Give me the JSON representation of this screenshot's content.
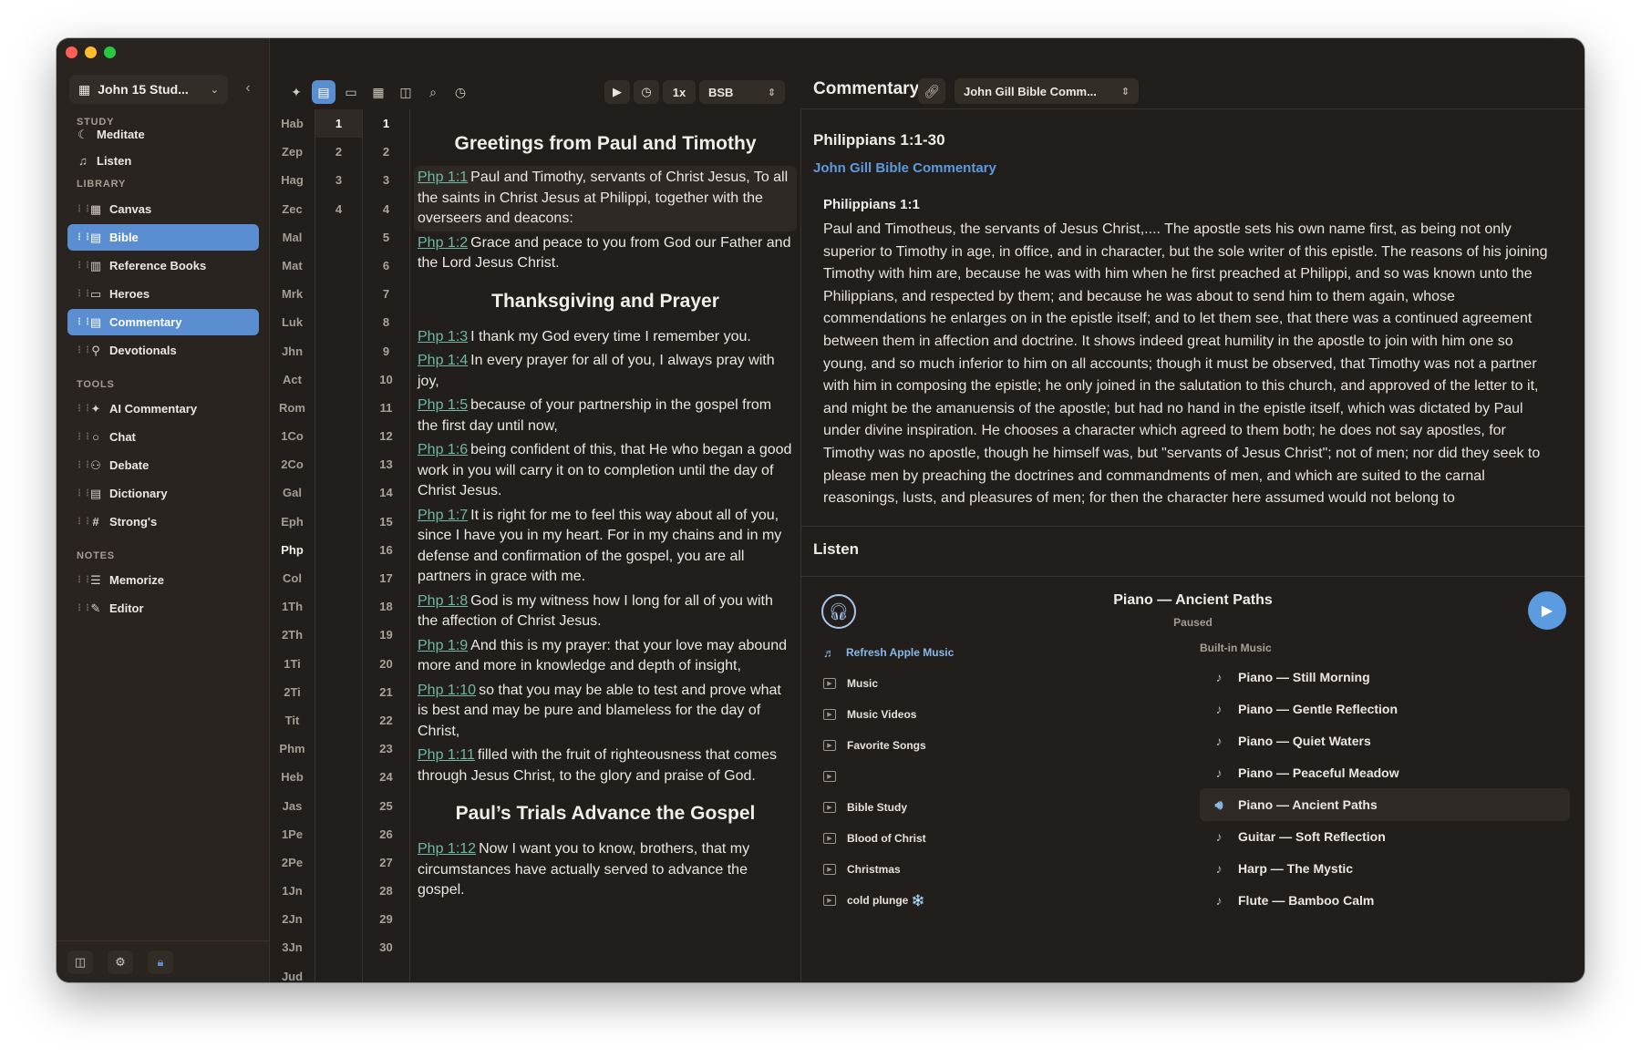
{
  "sidebar": {
    "study_name": "John 15 Stud...",
    "sections": {
      "study": "STUDY",
      "library": "LIBRARY",
      "tools": "TOOLS",
      "notes": "NOTES"
    },
    "study_items": [
      {
        "label": "Meditate",
        "icon": "moon-icon"
      },
      {
        "label": "Listen",
        "icon": "headphones-icon"
      }
    ],
    "library_items": [
      {
        "label": "Canvas",
        "icon": "grid-icon",
        "active": false
      },
      {
        "label": "Bible",
        "icon": "book-icon",
        "active": true
      },
      {
        "label": "Reference Books",
        "icon": "library-icon",
        "active": false
      },
      {
        "label": "Heroes",
        "icon": "id-card-icon",
        "active": false
      },
      {
        "label": "Commentary",
        "icon": "book-icon",
        "active": true
      },
      {
        "label": "Devotionals",
        "icon": "pray-icon",
        "active": false
      }
    ],
    "tool_items": [
      {
        "label": "AI Commentary",
        "icon": "sparkle-icon"
      },
      {
        "label": "Chat",
        "icon": "chat-bubble-icon"
      },
      {
        "label": "Debate",
        "icon": "people-icon"
      },
      {
        "label": "Dictionary",
        "icon": "dictionary-icon"
      },
      {
        "label": "Strong's",
        "icon": "hash-icon"
      }
    ],
    "note_items": [
      {
        "label": "Memorize",
        "icon": "list-icon"
      },
      {
        "label": "Editor",
        "icon": "edit-icon"
      }
    ]
  },
  "toolbar": {
    "speed": "1x",
    "translation": "BSB"
  },
  "books": [
    "Hab",
    "Zep",
    "Hag",
    "Zec",
    "Mal",
    "Mat",
    "Mrk",
    "Luk",
    "Jhn",
    "Act",
    "Rom",
    "1Co",
    "2Co",
    "Gal",
    "Eph",
    "Php",
    "Col",
    "1Th",
    "2Th",
    "1Ti",
    "2Ti",
    "Tit",
    "Phm",
    "Heb",
    "Jas",
    "1Pe",
    "2Pe",
    "1Jn",
    "2Jn",
    "3Jn",
    "Jud"
  ],
  "selected_book": "Php",
  "chapters": [
    "1",
    "2",
    "3",
    "4"
  ],
  "verse_numbers": [
    "1",
    "2",
    "3",
    "4",
    "5",
    "6",
    "7",
    "8",
    "9",
    "10",
    "11",
    "12",
    "13",
    "14",
    "15",
    "16",
    "17",
    "18",
    "19",
    "20",
    "21",
    "22",
    "23",
    "24",
    "25",
    "26",
    "27",
    "28",
    "29",
    "30"
  ],
  "passage": {
    "headings": [
      "Greetings from Paul and Timothy",
      "Thanksgiving and Prayer",
      "Paul’s Trials Advance the Gospel"
    ],
    "verses": [
      {
        "ref": "Php 1:1",
        "text": "Paul and Timothy, servants of Christ Jesus, To all the saints in Christ Jesus at Philippi, together with the overseers and deacons:"
      },
      {
        "ref": "Php 1:2",
        "text": "Grace and peace to you from God our Father and the Lord Jesus Christ."
      },
      {
        "ref": "Php 1:3",
        "text": "I thank my God every time I remember you."
      },
      {
        "ref": "Php 1:4",
        "text": "In every prayer for all of you, I always pray with joy,"
      },
      {
        "ref": "Php 1:5",
        "text": "because of your partnership in the gospel from the first day until now,"
      },
      {
        "ref": "Php 1:6",
        "text": "being confident of this, that He who began a good work in you will carry it on to completion until the day of Christ Jesus."
      },
      {
        "ref": "Php 1:7",
        "text": "It is right for me to feel this way about all of you, since I have you in my heart. For in my chains and in my defense and confirmation of the gospel, you are all partners in grace with me."
      },
      {
        "ref": "Php 1:8",
        "text": "God is my witness how I long for all of you with the affection of Christ Jesus."
      },
      {
        "ref": "Php 1:9",
        "text": "And this is my prayer: that your love may abound more and more in knowledge and depth of insight,"
      },
      {
        "ref": "Php 1:10",
        "text": "so that you may be able to test and prove what is best and may be pure and blameless for the day of Christ,"
      },
      {
        "ref": "Php 1:11",
        "text": "filled with the fruit of righteousness that comes through Jesus Christ, to the glory and praise of God."
      },
      {
        "ref": "Php 1:12",
        "text": "Now I want you to know, brothers, that my circumstances have actually served to advance the gospel."
      }
    ]
  },
  "commentary": {
    "title": "Commentary",
    "source_select": "John Gill Bible Comm...",
    "range": "Philippians 1:1-30",
    "source_name": "John Gill Bible Commentary",
    "verse_heading": "Philippians 1:1",
    "body": "Paul and Timotheus, the servants of Jesus Christ,.... The apostle sets his own name first, as being not only superior to Timothy in age, in office, and in character, but the sole writer of this epistle. The reasons of his joining Timothy with him are, because he was with him when he first preached at Philippi, and so was known unto the Philippians, and respected by them; and because he was about to send him to them again, whose commendations he enlarges on in the epistle itself; and to let them see, that there was a continued agreement between them in affection and doctrine. It shows indeed great humility in the apostle to join with him one so young, and so much inferior to him on all accounts; though it must be observed, that Timothy was not a partner with him in composing the epistle; he only joined in the salutation to this church, and approved of the letter to it, and might be the amanuensis of the apostle; but had no hand in the epistle itself, which was dictated by Paul under divine inspiration. He chooses a character which agreed to them both; he does not say apostles, for Timothy was no apostle, though he himself was, but \"servants of Jesus Christ\"; not of men; nor did they seek to please men by preaching the doctrines and commandments of men, and which are suited to the carnal reasonings, lusts, and pleasures of men; for then the character here assumed would not belong to"
  },
  "listen": {
    "title": "Listen",
    "now_playing": "Piano — Ancient Paths",
    "status": "Paused",
    "refresh_label": "Refresh Apple Music",
    "playlists": [
      "Music",
      "Music Videos",
      "Favorite Songs",
      "",
      "Bible Study",
      "Blood of Christ",
      "Christmas",
      "cold plunge ❄️"
    ],
    "builtin_label": "Built-in Music",
    "tracks": [
      "Piano — Still Morning",
      "Piano — Gentle Reflection",
      "Piano — Quiet Waters",
      "Piano — Peaceful Meadow",
      "Piano — Ancient Paths",
      "Guitar — Soft Reflection",
      "Harp — The Mystic",
      "Flute — Bamboo Calm"
    ],
    "playing_index": 4
  },
  "colors": {
    "accent": "#5b8ed1",
    "link": "#6fb8a4",
    "background": "#221e1b"
  }
}
